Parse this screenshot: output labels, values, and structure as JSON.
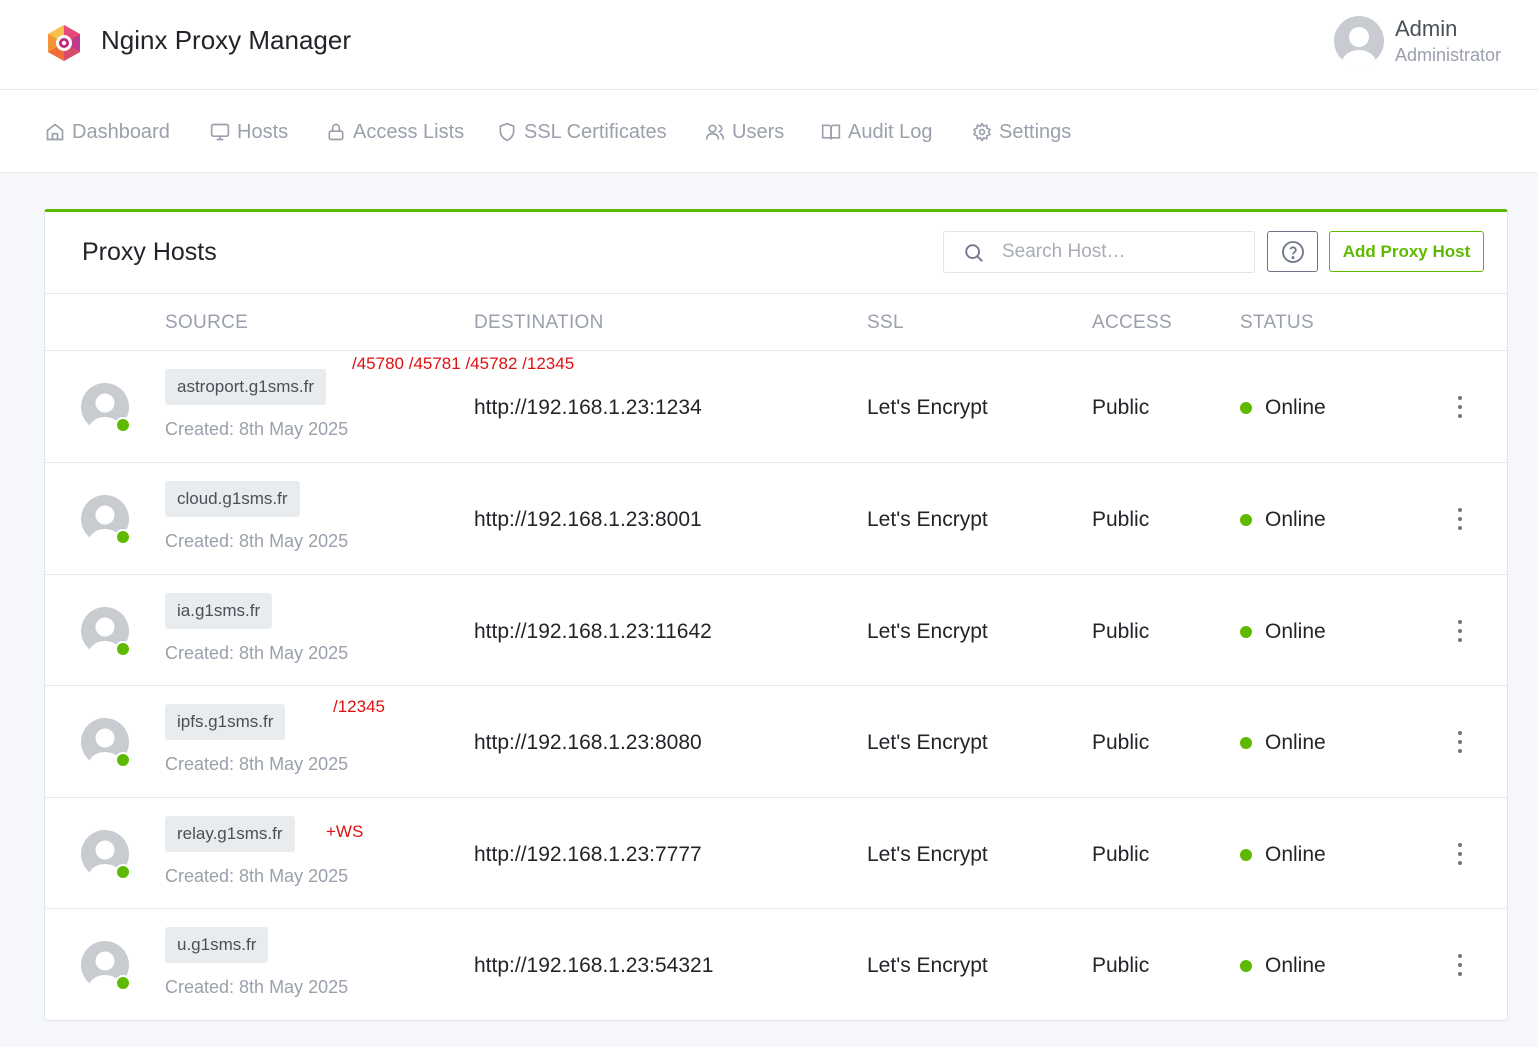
{
  "header": {
    "app_title": "Nginx Proxy Manager",
    "user_name": "Admin",
    "user_role": "Administrator",
    "brand_color": "#5eba00"
  },
  "nav": [
    {
      "label": "Dashboard",
      "icon": "home-icon"
    },
    {
      "label": "Hosts",
      "icon": "monitor-icon"
    },
    {
      "label": "Access Lists",
      "icon": "lock-icon"
    },
    {
      "label": "SSL Certificates",
      "icon": "shield-icon"
    },
    {
      "label": "Users",
      "icon": "users-icon"
    },
    {
      "label": "Audit Log",
      "icon": "book-icon"
    },
    {
      "label": "Settings",
      "icon": "gear-icon"
    }
  ],
  "card": {
    "title": "Proxy Hosts",
    "search_placeholder": "Search Host…",
    "add_button": "Add Proxy Host"
  },
  "table": {
    "columns": [
      "SOURCE",
      "DESTINATION",
      "SSL",
      "ACCESS",
      "STATUS"
    ],
    "rows": [
      {
        "domain": "astroport.g1sms.fr",
        "created": "Created: 8th May 2025",
        "destination": "http://192.168.1.23:1234",
        "ssl": "Let's Encrypt",
        "access": "Public",
        "status": "Online",
        "note": "/45780 /45781 /45782 /12345"
      },
      {
        "domain": "cloud.g1sms.fr",
        "created": "Created: 8th May 2025",
        "destination": "http://192.168.1.23:8001",
        "ssl": "Let's Encrypt",
        "access": "Public",
        "status": "Online",
        "note": ""
      },
      {
        "domain": "ia.g1sms.fr",
        "created": "Created: 8th May 2025",
        "destination": "http://192.168.1.23:11642",
        "ssl": "Let's Encrypt",
        "access": "Public",
        "status": "Online",
        "note": ""
      },
      {
        "domain": "ipfs.g1sms.fr",
        "created": "Created: 8th May 2025",
        "destination": "http://192.168.1.23:8080",
        "ssl": "Let's Encrypt",
        "access": "Public",
        "status": "Online",
        "note": "/12345"
      },
      {
        "domain": "relay.g1sms.fr",
        "created": "Created: 8th May 2025",
        "destination": "http://192.168.1.23:7777",
        "ssl": "Let's Encrypt",
        "access": "Public",
        "status": "Online",
        "note": "+WS"
      },
      {
        "domain": "u.g1sms.fr",
        "created": "Created: 8th May 2025",
        "destination": "http://192.168.1.23:54321",
        "ssl": "Let's Encrypt",
        "access": "Public",
        "status": "Online",
        "note": ""
      }
    ]
  }
}
